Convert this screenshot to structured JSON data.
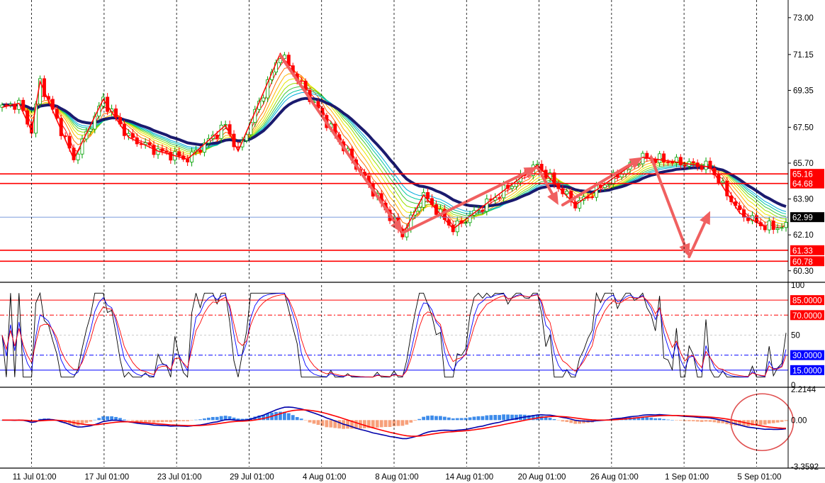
{
  "chart_data": [
    {
      "type": "candlestick",
      "panel": "price",
      "x_dates": [
        "11 Jul 01:00",
        "17 Jul 01:00",
        "23 Jul 01:00",
        "29 Jul 01:00",
        "4 Aug 01:00",
        "8 Aug 01:00",
        "14 Aug 01:00",
        "20 Aug 01:00",
        "26 Aug 01:00",
        "1 Sep 01:00",
        "5 Sep 01:00"
      ],
      "y_ticks": [
        "73.00",
        "71.15",
        "69.35",
        "67.50",
        "65.70",
        "63.90",
        "62.10",
        "60.30"
      ],
      "ylim": [
        59.9,
        73.6
      ],
      "grid": "vertical dashed at date ticks",
      "current_price": {
        "value": 62.99,
        "label": "62.99"
      },
      "levels": [
        {
          "value": 65.16,
          "label": "65.16",
          "color": "#ff0000"
        },
        {
          "value": 64.68,
          "label": "64.68",
          "color": "#ff0000"
        },
        {
          "value": 61.33,
          "label": "61.33",
          "color": "#ff0000"
        },
        {
          "value": 60.78,
          "label": "60.78",
          "color": "#ff0000"
        }
      ],
      "zigzag": [
        {
          "x": 0,
          "y": 68.5
        },
        {
          "x": 4,
          "y": 68.7
        },
        {
          "x": 7,
          "y": 67.3
        },
        {
          "x": 9,
          "y": 69.8
        },
        {
          "x": 17,
          "y": 65.9
        },
        {
          "x": 24,
          "y": 68.9
        },
        {
          "x": 30,
          "y": 67.0
        },
        {
          "x": 37,
          "y": 66.3
        },
        {
          "x": 44,
          "y": 65.9
        },
        {
          "x": 53,
          "y": 67.6
        },
        {
          "x": 56,
          "y": 66.3
        },
        {
          "x": 66,
          "y": 71.2
        },
        {
          "x": 95,
          "y": 62.1
        },
        {
          "x": 100,
          "y": 64.1
        },
        {
          "x": 107,
          "y": 62.4
        },
        {
          "x": 127,
          "y": 65.6
        },
        {
          "x": 136,
          "y": 63.6
        },
        {
          "x": 152,
          "y": 66.0
        },
        {
          "x": 168,
          "y": 65.5
        },
        {
          "x": 175,
          "y": 63.2
        },
        {
          "x": 181,
          "y": 62.5
        }
      ],
      "trend_arrows": [
        {
          "from": [
            66,
            71.1
          ],
          "to": [
            95,
            62.2
          ]
        },
        {
          "from": [
            95,
            62.2
          ],
          "to": [
            127,
            65.5
          ]
        },
        {
          "from": [
            127,
            65.5
          ],
          "to": [
            132,
            63.6
          ]
        },
        {
          "from": [
            133,
            63.6
          ],
          "to": [
            152,
            66.0
          ]
        },
        {
          "from": [
            154,
            66.0
          ],
          "to": [
            163,
            61.0
          ]
        },
        {
          "from": [
            163,
            61.0
          ],
          "to": [
            168,
            63.3
          ]
        }
      ],
      "moving_averages": {
        "main_color": "#1a1a6e",
        "fan_colors": [
          "#ff0000",
          "#ff6a00",
          "#ffb400",
          "#e6e600",
          "#9be000",
          "#3cc83c",
          "#00c8a0",
          "#00aadc"
        ]
      }
    },
    {
      "type": "line",
      "panel": "oscillator",
      "y_ticks": [
        "100",
        "50",
        "0"
      ],
      "ylim": [
        0,
        100
      ],
      "levels": [
        {
          "value": 85,
          "label": "85.0000",
          "color": "#ff0000",
          "style": "solid"
        },
        {
          "value": 70,
          "label": "70.0000",
          "color": "#ff0000",
          "style": "dash-dot"
        },
        {
          "value": 30,
          "label": "30.0000",
          "color": "#0000ff",
          "style": "dash-dot"
        },
        {
          "value": 15,
          "label": "15.0000",
          "color": "#0000ff",
          "style": "solid"
        }
      ],
      "series_colors": [
        "#000000",
        "#0000ff",
        "#ff0000"
      ]
    },
    {
      "type": "histogram",
      "panel": "macd",
      "y_ticks": [
        "2.2144",
        "0.00",
        "-3.3592"
      ],
      "ylim": [
        -3.3592,
        2.2144
      ],
      "histogram_colors": {
        "positive": "#3d8bea",
        "negative": "#f7a07a"
      },
      "line_colors": [
        "#0000aa",
        "#ff0000"
      ],
      "annotation": {
        "shape": "ellipse",
        "color": "#e05050",
        "near_date": "5 Sep 01:00"
      }
    }
  ],
  "colors": {
    "background": "#ffffff",
    "up_candle": "#00a000",
    "down_candle": "#ff0000",
    "arrow": "#f06060",
    "grid": "#000000",
    "current_price_line": "#6a8fd8"
  }
}
